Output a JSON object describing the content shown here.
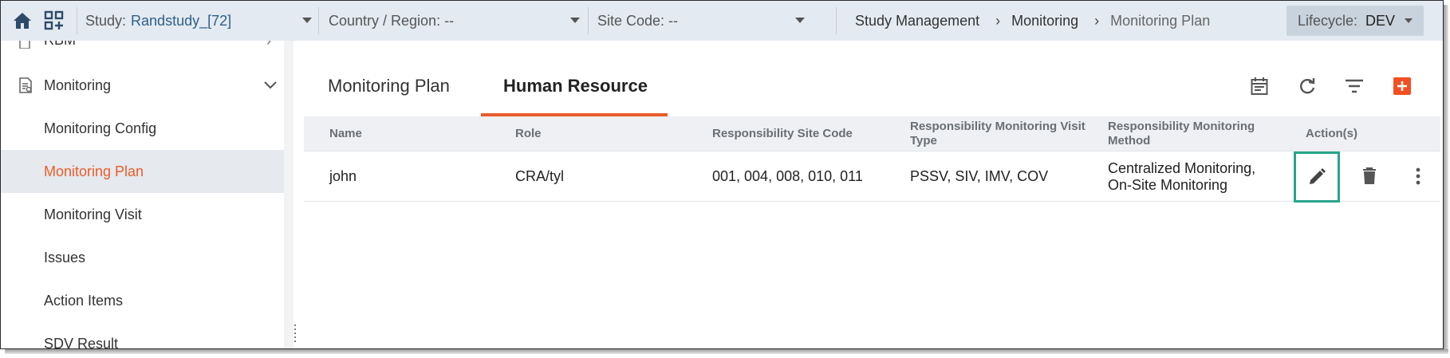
{
  "topbar": {
    "study_label": "Study:",
    "study_value": "Randstudy_[72]",
    "country_label": "Country / Region: --",
    "site_label": "Site Code: --",
    "breadcrumb": [
      "Study Management",
      "Monitoring",
      "Monitoring Plan"
    ],
    "breadcrumb_sep": "›",
    "lifecycle_label": "Lifecycle:",
    "lifecycle_value": "DEV"
  },
  "sidebar": {
    "partial_item": "RBM",
    "parent_label": "Monitoring",
    "items": [
      {
        "label": "Monitoring Config"
      },
      {
        "label": "Monitoring Plan",
        "active": true
      },
      {
        "label": "Monitoring Visit"
      },
      {
        "label": "Issues"
      },
      {
        "label": "Action Items"
      },
      {
        "label": "SDV Result"
      }
    ]
  },
  "tabs": [
    "Monitoring Plan",
    "Human Resource"
  ],
  "active_tab": "Human Resource",
  "table": {
    "headers": {
      "name": "Name",
      "role": "Role",
      "site_code": "Responsibility Site Code",
      "visit_type": "Responsibility Monitoring Visit Type",
      "method": "Responsibility Monitoring Method",
      "actions": "Action(s)"
    },
    "rows": [
      {
        "name": "john",
        "role": "CRA/tyl",
        "site_code": "001, 004, 008, 010, 011",
        "visit_type": "PSSV, SIV, IMV, COV",
        "method": "Centralized Monitoring, On-Site Monitoring"
      }
    ]
  },
  "icons": {
    "home": "home-icon",
    "apps": "apps-add-icon",
    "calendar": "calendar-icon",
    "refresh": "refresh-icon",
    "filter": "filter-icon",
    "add": "add-icon",
    "edit": "edit-icon",
    "delete": "delete-icon",
    "more": "more-vertical-icon"
  },
  "colors": {
    "accent": "#e85d2a",
    "topbar_bg": "#e4eaf1",
    "highlight_box": "#2aa58a",
    "study_value": "#2e5f8a"
  }
}
